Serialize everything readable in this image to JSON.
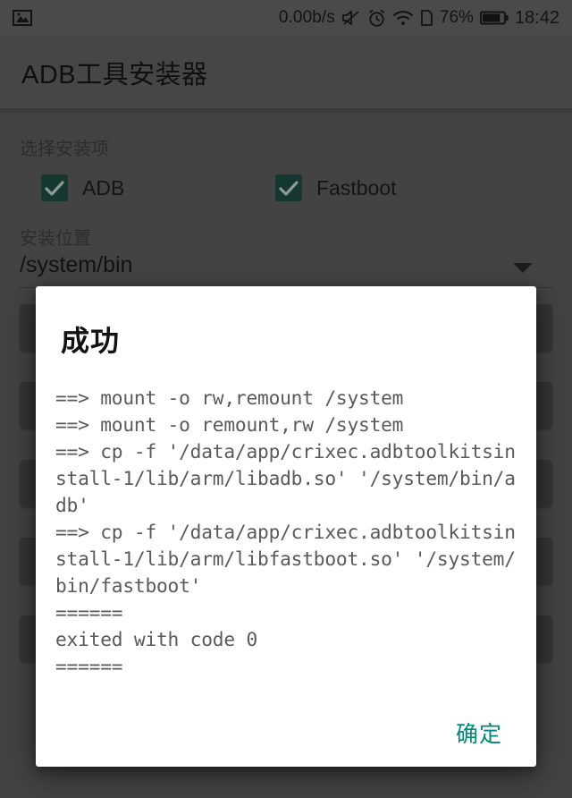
{
  "statusbar": {
    "notification_icon": "photo-icon",
    "network_speed": "0.00b/s",
    "icons": [
      "mute-icon",
      "alarm-icon",
      "wifi-icon",
      "sim-card-icon"
    ],
    "battery_percent": "76%",
    "battery_icon": "battery-icon",
    "clock": "18:42"
  },
  "appbar": {
    "title": "ADB工具安装器"
  },
  "content": {
    "items_label": "选择安装项",
    "checkboxes": [
      {
        "label": "ADB",
        "checked": true
      },
      {
        "label": "Fastboot",
        "checked": true
      }
    ],
    "location_label": "安装位置",
    "spinner": {
      "value": "/system/bin",
      "arrow_icon": "chevron-down-icon"
    }
  },
  "dialog": {
    "title": "成功",
    "log": "==> mount -o rw,remount /system\n==> mount -o remount,rw /system\n==> cp -f '/data/app/crixec.adbtoolkitsinstall-1/lib/arm/libadb.so' '/system/bin/adb'\n==> cp -f '/data/app/crixec.adbtoolkitsinstall-1/lib/arm/libfastboot.so' '/system/bin/fastboot'\n======\nexited with code 0\n======",
    "ok_label": "确定",
    "accent_color": "#00897b"
  },
  "colors": {
    "checkbox_checked": "#1d5045",
    "accent": "#00897b",
    "window_background": "#616161",
    "dialog_background": "#ffffff"
  }
}
